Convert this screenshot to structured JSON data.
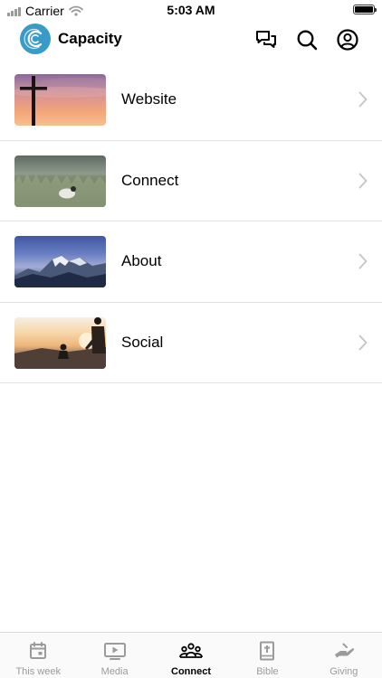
{
  "status_bar": {
    "carrier": "Carrier",
    "time": "5:03 AM",
    "icons": [
      "signal-icon",
      "wifi-icon",
      "battery-icon"
    ]
  },
  "header": {
    "title": "Capacity",
    "logo_color": "#3a9bc7",
    "icons": [
      "chat-icon",
      "search-icon",
      "profile-icon"
    ]
  },
  "list": {
    "items": [
      {
        "label": "Website",
        "image": "sunset-cross"
      },
      {
        "label": "Connect",
        "image": "field-lamb"
      },
      {
        "label": "About",
        "image": "mountains"
      },
      {
        "label": "Social",
        "image": "sunset-hikers"
      }
    ]
  },
  "tabbar": {
    "active": "Connect",
    "tabs": [
      {
        "label": "This week",
        "icon": "calendar-icon"
      },
      {
        "label": "Media",
        "icon": "play-icon"
      },
      {
        "label": "Connect",
        "icon": "people-icon"
      },
      {
        "label": "Bible",
        "icon": "bible-icon"
      },
      {
        "label": "Giving",
        "icon": "giving-hand-icon"
      }
    ]
  }
}
